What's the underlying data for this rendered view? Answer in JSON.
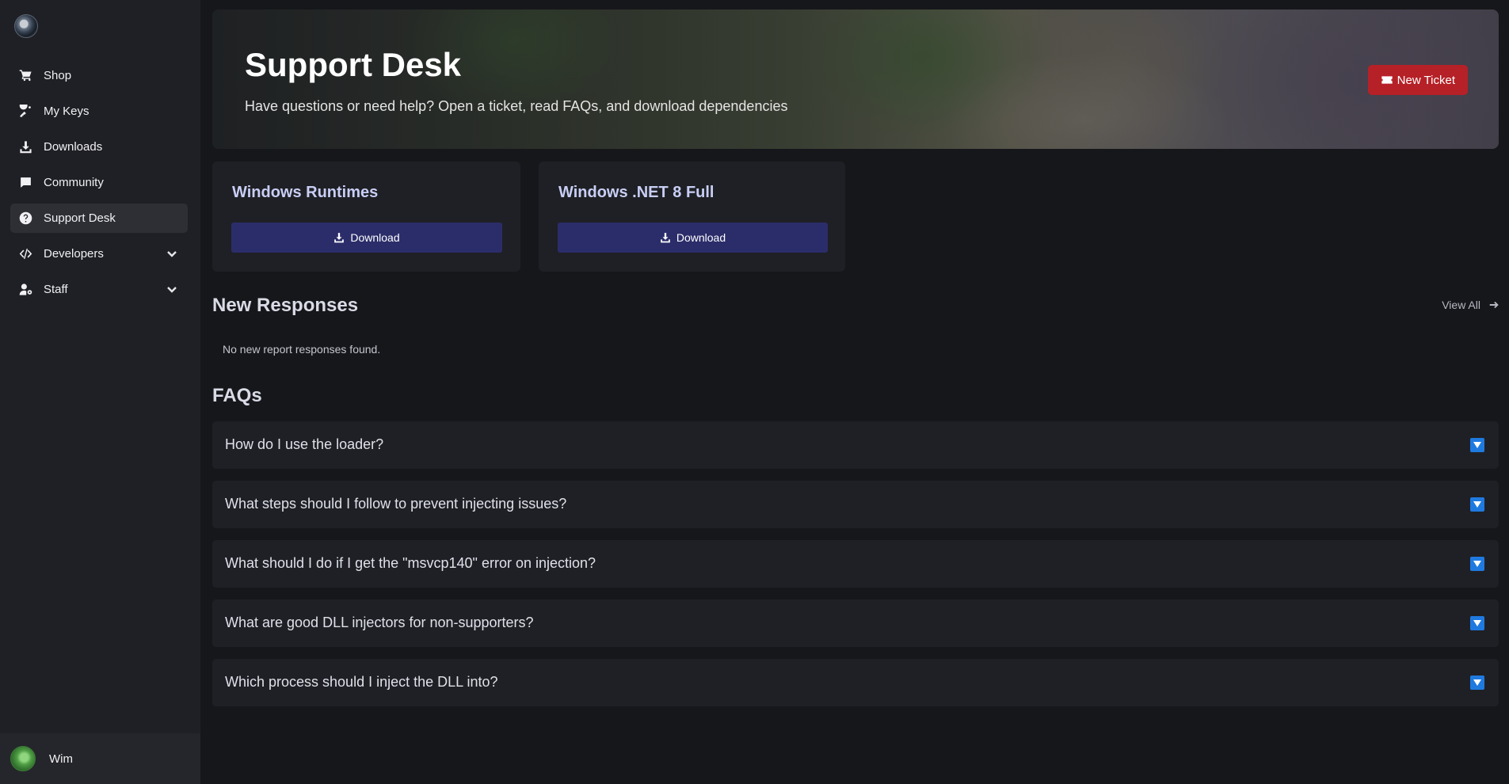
{
  "sidebar": {
    "items": [
      {
        "label": "Shop",
        "icon": "cart-icon"
      },
      {
        "label": "My Keys",
        "icon": "key-icon"
      },
      {
        "label": "Downloads",
        "icon": "download-icon"
      },
      {
        "label": "Community",
        "icon": "chat-icon"
      },
      {
        "label": "Support Desk",
        "icon": "question-icon",
        "active": true
      },
      {
        "label": "Developers",
        "icon": "code-icon",
        "expandable": true
      },
      {
        "label": "Staff",
        "icon": "user-gear-icon",
        "expandable": true
      }
    ],
    "user": {
      "name": "Wim"
    }
  },
  "hero": {
    "title": "Support Desk",
    "subtitle": "Have questions or need help? Open a ticket, read FAQs, and download dependencies",
    "new_ticket_label": "New Ticket"
  },
  "downloads": [
    {
      "title": "Windows Runtimes",
      "button_label": "Download"
    },
    {
      "title": "Windows .NET 8 Full",
      "button_label": "Download"
    }
  ],
  "responses": {
    "title": "New Responses",
    "view_all_label": "View All",
    "empty_text": "No new report responses found."
  },
  "faqs": {
    "title": "FAQs",
    "items": [
      "How do I use the loader?",
      "What steps should I follow to prevent injecting issues?",
      "What should I do if I get the \"msvcp140\" error on injection?",
      "What are good DLL injectors for non-supporters?",
      "Which process should I inject the DLL into?"
    ]
  },
  "colors": {
    "accent_red": "#b52127",
    "download_button": "#2b2d6a",
    "faq_toggle": "#1f7ae0",
    "card_title": "#c9cef5"
  }
}
